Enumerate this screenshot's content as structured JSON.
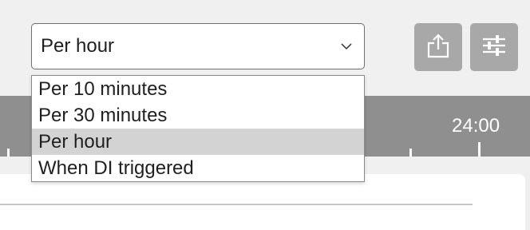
{
  "interval_select": {
    "value": "Per hour",
    "options": [
      {
        "label": "Per 10 minutes",
        "selected": false
      },
      {
        "label": "Per 30 minutes",
        "selected": false
      },
      {
        "label": "Per hour",
        "selected": true
      },
      {
        "label": "When DI triggered",
        "selected": false
      }
    ]
  },
  "toolbar": {
    "export_icon": "export-icon",
    "settings_icon": "sliders-icon"
  },
  "timeline": {
    "end_label": "24:00"
  },
  "colors": {
    "icon_button_bg": "#a8a8a8",
    "timeline_bg": "#8f8f8f",
    "selected_option_bg": "#d3d3d3"
  }
}
